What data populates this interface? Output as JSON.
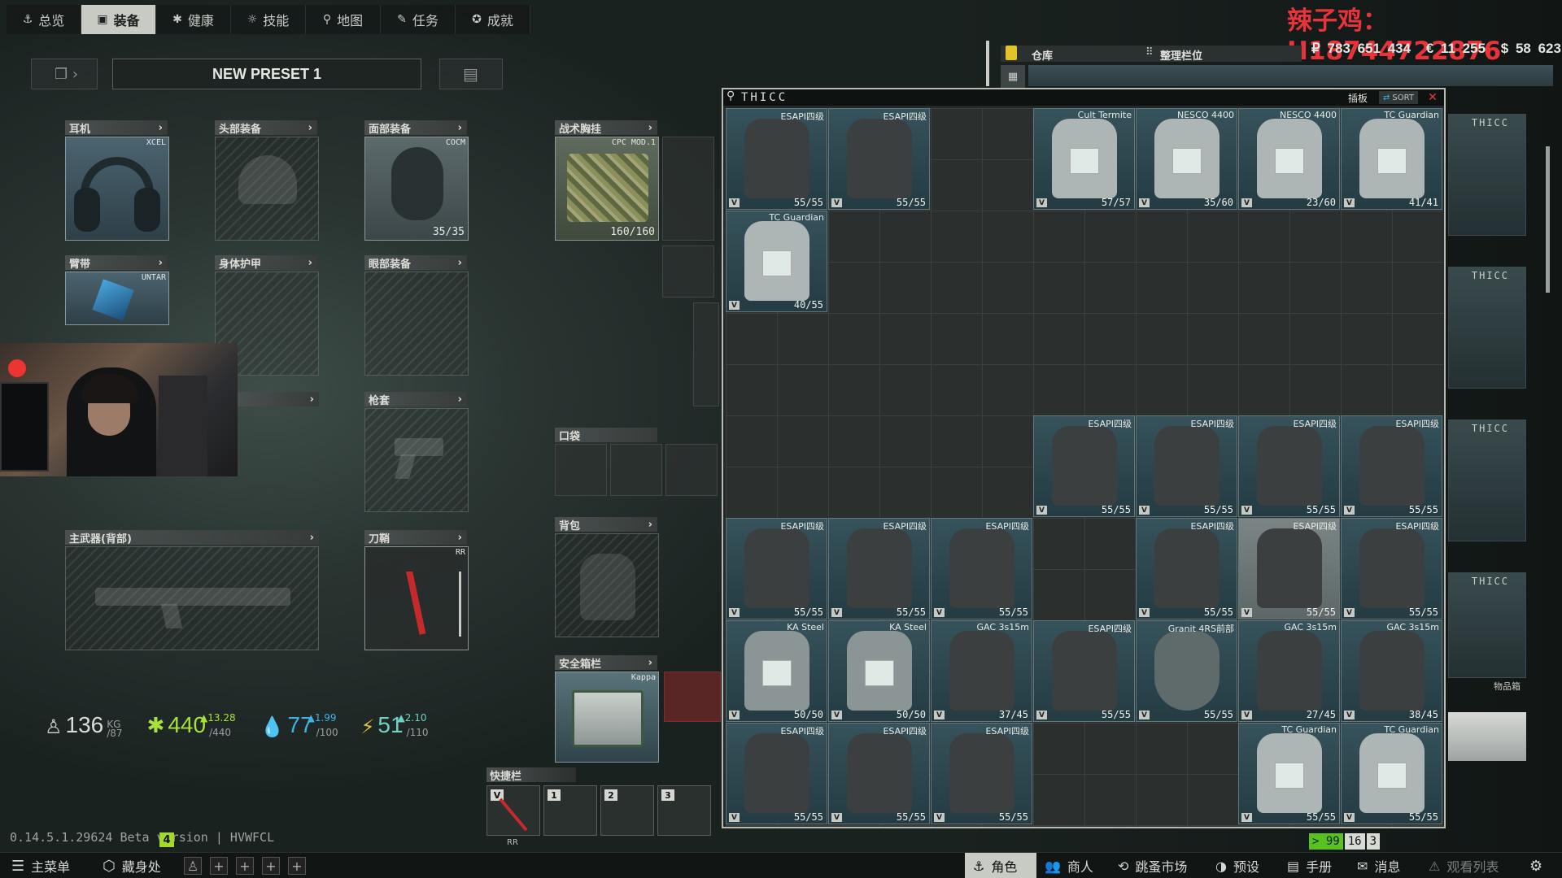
{
  "nav": {
    "tabs": [
      {
        "label": "总览",
        "icon": "anchor-icon"
      },
      {
        "label": "装备",
        "icon": "vest-icon"
      },
      {
        "label": "健康",
        "icon": "health-icon"
      },
      {
        "label": "技能",
        "icon": "skills-icon"
      },
      {
        "label": "地图",
        "icon": "map-pin-icon"
      },
      {
        "label": "任务",
        "icon": "task-icon"
      },
      {
        "label": "成就",
        "icon": "achievement-icon"
      }
    ]
  },
  "overlay": {
    "streamer": "辣子鸡：H18744722876"
  },
  "preset": {
    "title": "NEW PRESET 1"
  },
  "slots": {
    "earpiece": {
      "label": "耳机",
      "tag": "XCEL"
    },
    "headwear": {
      "label": "头部装备"
    },
    "faceCover": {
      "label": "面部装备",
      "tag": "COCM",
      "dur": "35/35"
    },
    "rig": {
      "label": "战术胸挂",
      "tag": "CPC MOD.1",
      "dur": "160/160"
    },
    "armband": {
      "label": "臂带",
      "tag": "UNTAR"
    },
    "bodyArmor": {
      "label": "身体护甲"
    },
    "eyewear": {
      "label": "眼部装备"
    },
    "holster": {
      "label": "枪套"
    },
    "pockets": {
      "label": "口袋"
    },
    "primary": {
      "label": "主武器(背部)"
    },
    "scabbard": {
      "label": "刀鞘",
      "tag": "RR"
    },
    "backpack": {
      "label": "背包"
    },
    "secure": {
      "label": "安全箱栏",
      "tag": "Kappa"
    },
    "hotbar": {
      "label": "快捷栏",
      "keys": [
        "V",
        "1",
        "2",
        "3"
      ],
      "tag": "RR"
    }
  },
  "stats": {
    "weight": {
      "value": "136",
      "unit": "KG",
      "max": "/87"
    },
    "energy": {
      "value": "440",
      "max": "/440",
      "rate": "▲13.28"
    },
    "hydration": {
      "value": "77",
      "max": "/100",
      "rate": "▲1.99"
    },
    "stamina": {
      "value": "51",
      "max": "/110",
      "rate": "▲2.10"
    }
  },
  "version": {
    "text": "0.14.5.1.29624 Beta version | HVWFCL",
    "badge": "4"
  },
  "bottom": {
    "menu": "主菜单",
    "hideout": "藏身处",
    "character": "角色",
    "traders": "商人",
    "flea": "跳蚤市场",
    "presets": "预设",
    "handbook": "手册",
    "messages": "消息",
    "watchlist": "观看列表"
  },
  "stash": {
    "tab1": "仓库",
    "tab2": "整理栏位",
    "tags": [
      "THICC",
      "THICC",
      "THICC",
      "THICC"
    ],
    "itemcase": "物品箱"
  },
  "money": {
    "roubles": "₽ 783 651 434",
    "euros": "€ 11 255",
    "dollars": "$ 58 623"
  },
  "modal": {
    "title": "THICC",
    "tab": "插板",
    "sort": "SORT"
  },
  "items": [
    {
      "r": 0,
      "c": 0,
      "name": "ESAPI四级",
      "dur": "55/55",
      "type": "dark"
    },
    {
      "r": 0,
      "c": 1,
      "name": "ESAPI四级",
      "dur": "55/55",
      "type": "dark"
    },
    {
      "r": 0,
      "c": 3,
      "name": "Cult Termite",
      "dur": "57/57",
      "type": "light"
    },
    {
      "r": 0,
      "c": 4,
      "name": "NESCO 4400",
      "dur": "35/60",
      "type": "light"
    },
    {
      "r": 0,
      "c": 5,
      "name": "NESCO 4400",
      "dur": "23/60",
      "type": "light"
    },
    {
      "r": 0,
      "c": 6,
      "name": "TC Guardian",
      "dur": "41/41",
      "type": "light"
    },
    {
      "r": 1,
      "c": 0,
      "name": "TC Guardian",
      "dur": "40/55",
      "type": "light"
    },
    {
      "r": 3,
      "c": 3,
      "name": "ESAPI四级",
      "dur": "55/55",
      "type": "dark"
    },
    {
      "r": 3,
      "c": 4,
      "name": "ESAPI四级",
      "dur": "55/55",
      "type": "dark"
    },
    {
      "r": 3,
      "c": 5,
      "name": "ESAPI四级",
      "dur": "55/55",
      "type": "dark"
    },
    {
      "r": 3,
      "c": 6,
      "name": "ESAPI四级",
      "dur": "55/55",
      "type": "dark"
    },
    {
      "r": 4,
      "c": 0,
      "name": "ESAPI四级",
      "dur": "55/55",
      "type": "dark"
    },
    {
      "r": 4,
      "c": 1,
      "name": "ESAPI四级",
      "dur": "55/55",
      "type": "dark"
    },
    {
      "r": 4,
      "c": 2,
      "name": "ESAPI四级",
      "dur": "55/55",
      "type": "dark"
    },
    {
      "r": 4,
      "c": 4,
      "name": "ESAPI四级",
      "dur": "55/55",
      "type": "dark"
    },
    {
      "r": 4,
      "c": 5,
      "name": "ESAPI四级",
      "dur": "55/55",
      "type": "dark",
      "hover": true
    },
    {
      "r": 4,
      "c": 6,
      "name": "ESAPI四级",
      "dur": "55/55",
      "type": "dark"
    },
    {
      "r": 5,
      "c": 0,
      "name": "KA Steel",
      "dur": "50/50",
      "type": "steel"
    },
    {
      "r": 5,
      "c": 1,
      "name": "KA Steel",
      "dur": "50/50",
      "type": "steel"
    },
    {
      "r": 5,
      "c": 2,
      "name": "GAC 3s15m",
      "dur": "37/45",
      "type": "dark"
    },
    {
      "r": 5,
      "c": 3,
      "name": "ESAPI四级",
      "dur": "55/55",
      "type": "dark"
    },
    {
      "r": 5,
      "c": 4,
      "name": "Granit 4RS前部",
      "dur": "55/55",
      "type": "granit"
    },
    {
      "r": 5,
      "c": 5,
      "name": "GAC 3s15m",
      "dur": "27/45",
      "type": "dark"
    },
    {
      "r": 5,
      "c": 6,
      "name": "GAC 3s15m",
      "dur": "38/45",
      "type": "dark"
    },
    {
      "r": 6,
      "c": 0,
      "name": "ESAPI四级",
      "dur": "55/55",
      "type": "dark"
    },
    {
      "r": 6,
      "c": 1,
      "name": "ESAPI四级",
      "dur": "55/55",
      "type": "dark"
    },
    {
      "r": 6,
      "c": 2,
      "name": "ESAPI四级",
      "dur": "55/55",
      "type": "dark"
    },
    {
      "r": 6,
      "c": 5,
      "name": "TC Guardian",
      "dur": "55/55",
      "type": "light"
    },
    {
      "r": 6,
      "c": 6,
      "name": "TC Guardian",
      "dur": "55/55",
      "type": "light"
    }
  ],
  "indicators": {
    "a": "> 99",
    "b": "16",
    "c": "3"
  }
}
